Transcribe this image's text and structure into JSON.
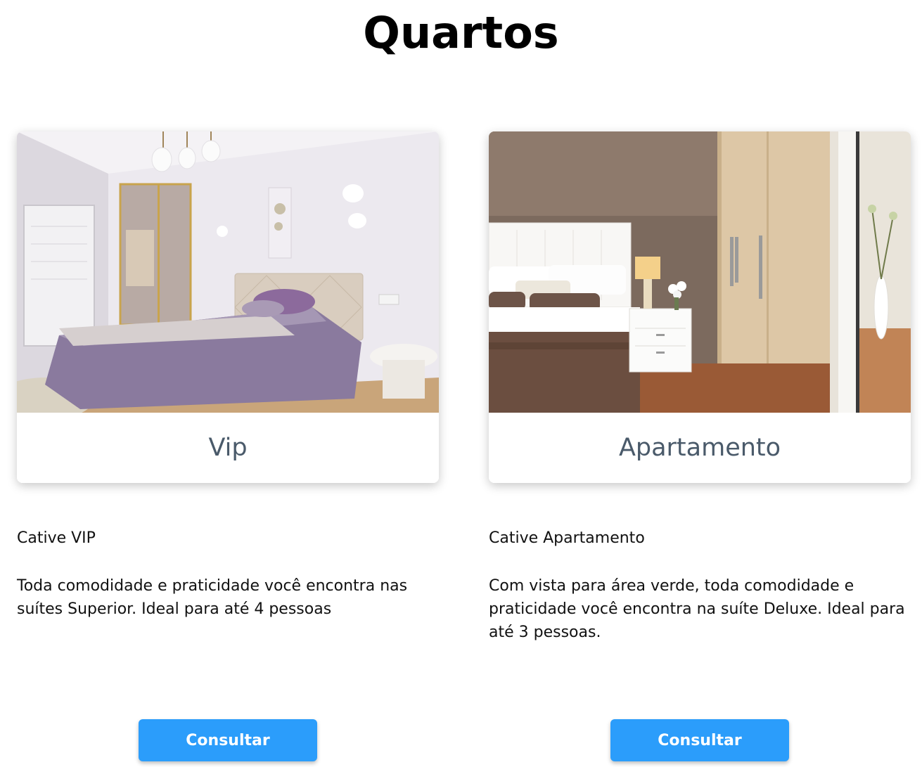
{
  "page": {
    "title": "Quartos"
  },
  "rooms": [
    {
      "name": "Vip",
      "subtitle": "Cative VIP",
      "description": "Toda comodidade e praticidade você encontra nas suítes Superior. Ideal para até 4 pessoas",
      "button_label": "Consultar"
    },
    {
      "name": "Apartamento",
      "subtitle": "Cative Apartamento",
      "description": "Com vista para área verde, toda comodidade e praticidade você encontra na suíte Deluxe. Ideal para até 3 pessoas.",
      "button_label": "Consultar"
    }
  ],
  "colors": {
    "button": "#2b9dfb",
    "card_title": "#4a5a6a"
  }
}
